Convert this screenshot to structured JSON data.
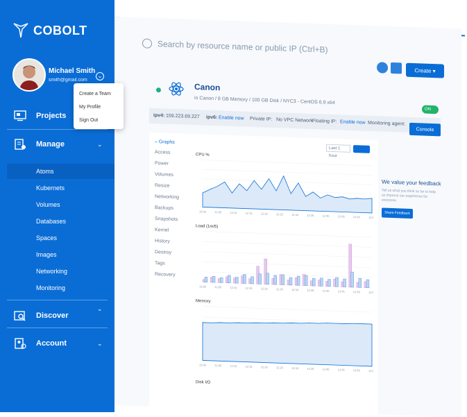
{
  "brand": {
    "name": "COBOLT"
  },
  "user": {
    "name": "Michael Smith",
    "email": "smith@gmail.com"
  },
  "user_menu": {
    "items": [
      "Create a Team",
      "My Profile",
      "Sign Out"
    ]
  },
  "nav": {
    "projects": "Projects",
    "manage": "Manage",
    "manage_items": [
      "Atoms",
      "Kubernets",
      "Volumes",
      "Databases",
      "Spaces",
      "Images",
      "Networking",
      "Monitoring"
    ],
    "discover": "Discover",
    "account": "Account"
  },
  "search": {
    "placeholder": "Search by resource name or public IP (Ctrl+B)"
  },
  "toolbar": {
    "create_label": "Create ▾"
  },
  "atom": {
    "name": "Canon",
    "meta": "in  Canon / 8 GB Memory / 100 GB Disk / NYC3 - CentOS 6.9 x64",
    "toggle": "ON"
  },
  "infobar": {
    "ipv4_label": "ipv4:",
    "ipv4_value": "159.223.69.227",
    "ipv6_label": "ipv6:",
    "ipv6_value": "Enable now",
    "private_label": "Private IP:",
    "private_value": "No VPC Network",
    "floating_label": "Floating IP:",
    "floating_value": "Enable now",
    "agent_label": "Monitoring agent:",
    "console_label": "Console"
  },
  "graphs": {
    "section_title": "– Graphs",
    "tabs": [
      "Access",
      "Power",
      "Volumes",
      "Resize",
      "Networking",
      "Backups",
      "Snapshots",
      "Kernel",
      "History",
      "Destroy",
      "Tags",
      "Recovery"
    ],
    "range": "Last 1 hour",
    "chart_titles": [
      "CPU %",
      "Load (1m/5)",
      "Memory",
      "Disk I/O"
    ]
  },
  "feedback": {
    "title": "We value your feedback",
    "text": "Tell us what you think so far to help us improve our experience for everyone.",
    "button": "Share Feedback"
  },
  "colors": {
    "primary": "#0a6dd6",
    "success": "#21b36a",
    "atom_dot": "#1fae8d"
  },
  "chart_data": [
    {
      "type": "area",
      "title": "CPU %",
      "x": [
        "12:00",
        "12:05",
        "12:10",
        "12:15",
        "12:20",
        "12:25",
        "12:30",
        "12:35",
        "12:40",
        "12:45",
        "12:50",
        "12:55"
      ],
      "ylim": [
        0,
        100
      ],
      "yticks": [
        0,
        20,
        40,
        60,
        80,
        100
      ],
      "series": [
        {
          "values": [
            30,
            38,
            45,
            55,
            32,
            52,
            38,
            60,
            42,
            65,
            40,
            72,
            35,
            58,
            30,
            40,
            28,
            35,
            30,
            32,
            28,
            30,
            29,
            31
          ]
        }
      ]
    },
    {
      "type": "bar",
      "title": "Load (1m/5)",
      "x": [
        "12:00",
        "12:05",
        "12:10",
        "12:15",
        "12:20",
        "12:25",
        "12:30",
        "12:35",
        "12:40",
        "12:45",
        "12:50",
        "12:55"
      ],
      "ylim": [
        0,
        1
      ],
      "series": [
        {
          "values": [
            0.05,
            0.1,
            0.08,
            0.12,
            0.1,
            0.15,
            0.1,
            0.35,
            0.5,
            0.12,
            0.2,
            0.1,
            0.15,
            0.22,
            0.1,
            0.12,
            0.1,
            0.15,
            0.1,
            0.85,
            0.1,
            0.12
          ]
        },
        {
          "values": [
            0.1,
            0.12,
            0.1,
            0.15,
            0.12,
            0.18,
            0.14,
            0.2,
            0.22,
            0.18,
            0.2,
            0.15,
            0.18,
            0.2,
            0.15,
            0.16,
            0.14,
            0.18,
            0.16,
            0.3,
            0.18,
            0.16
          ]
        }
      ]
    },
    {
      "type": "area",
      "title": "Memory",
      "x": [
        "12:00",
        "12:05",
        "12:10",
        "12:15",
        "12:20",
        "12:25",
        "12:30",
        "12:35",
        "12:40",
        "12:45",
        "12:50",
        "12:55"
      ],
      "ylim": [
        0,
        100
      ],
      "series": [
        {
          "values": [
            70,
            70,
            71,
            71,
            72,
            72,
            73,
            73,
            74,
            74,
            75,
            75,
            76,
            76,
            77,
            77,
            77,
            78,
            78,
            78
          ]
        }
      ]
    }
  ]
}
